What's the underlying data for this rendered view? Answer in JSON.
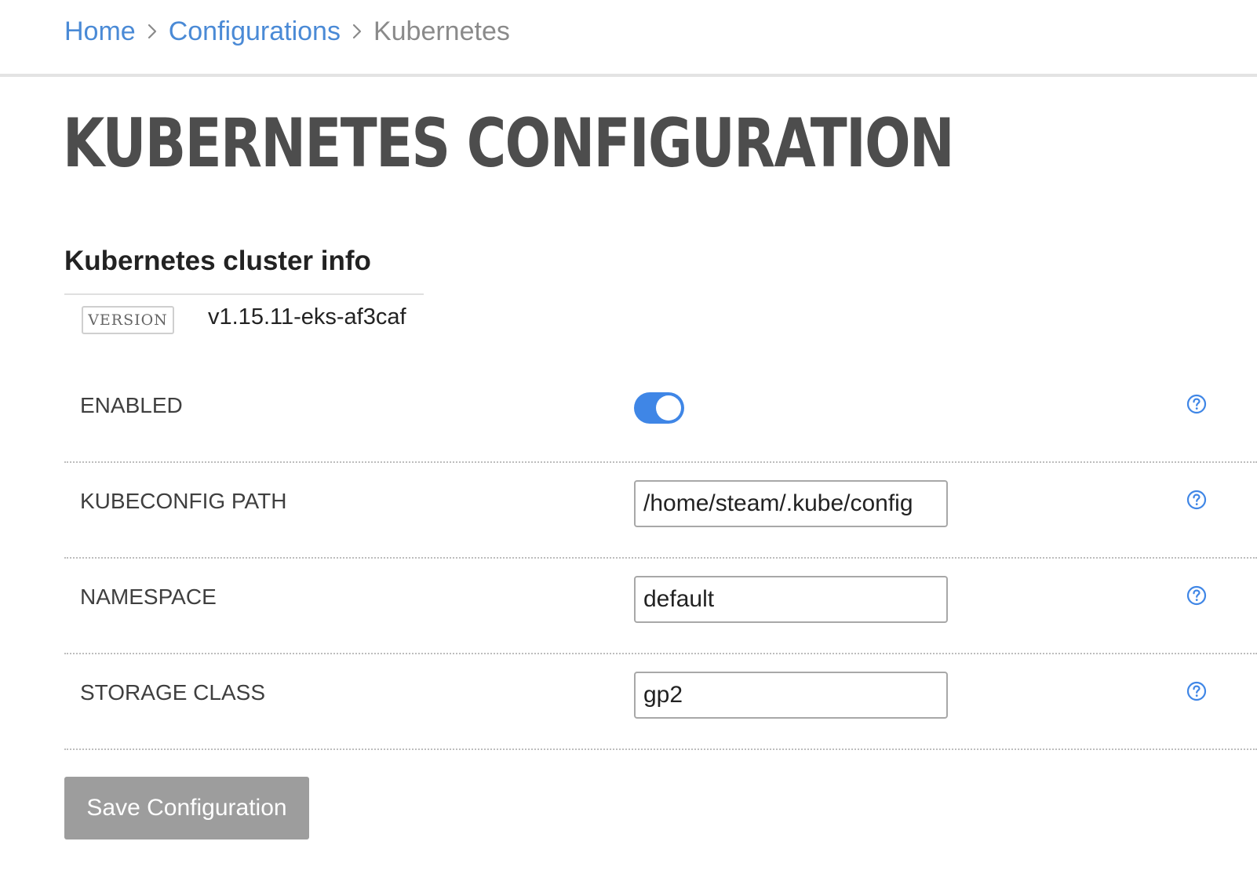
{
  "breadcrumb": {
    "home": "Home",
    "configurations": "Configurations",
    "current": "Kubernetes",
    "separator_icon": "chevron-right-icon"
  },
  "page_title": "KUBERNETES CONFIGURATION",
  "cluster_info": {
    "title": "Kubernetes cluster info",
    "version_label": "VERSION",
    "version_value": "v1.15.11-eks-af3caf"
  },
  "form": {
    "enabled": {
      "label": "ENABLED",
      "value": true,
      "help_icon": "question-circle-icon"
    },
    "kubeconfig_path": {
      "label": "KUBECONFIG PATH",
      "value": "/home/steam/.kube/config",
      "help_icon": "question-circle-icon"
    },
    "namespace": {
      "label": "NAMESPACE",
      "value": "default",
      "help_icon": "question-circle-icon"
    },
    "storage_class": {
      "label": "STORAGE CLASS",
      "value": "gp2",
      "help_icon": "question-circle-icon"
    }
  },
  "save_button": "Save Configuration",
  "colors": {
    "link": "#4a8ad6",
    "toggle_on": "#3f86e6",
    "title": "#4d4d4d",
    "button_disabled": "#9d9d9d"
  }
}
